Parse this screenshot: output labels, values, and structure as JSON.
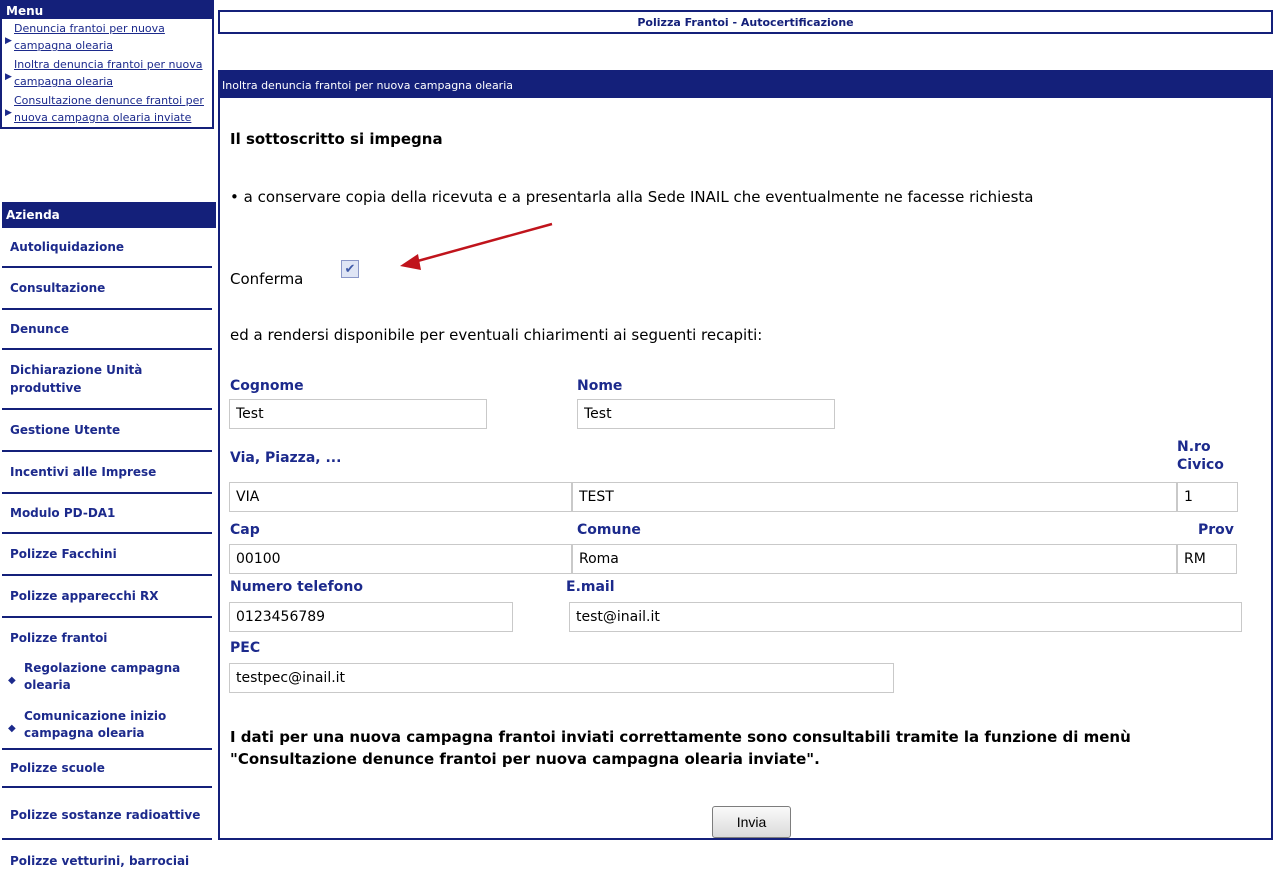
{
  "sidebar": {
    "menu_title": "Menu",
    "menu_links": [
      {
        "label": "Denuncia frantoi per nuova campagna olearia"
      },
      {
        "label": "Inoltra denuncia frantoi per nuova campagna olearia"
      },
      {
        "label": "Consultazione denunce frantoi per nuova campagna olearia inviate"
      }
    ],
    "azienda_title": "Azienda",
    "azienda_items": [
      "Autoliquidazione",
      "Consultazione",
      "Denunce",
      "Dichiarazione Unità produttive",
      "Gestione Utente",
      "Incentivi alle Imprese",
      "Modulo PD-DA1",
      "Polizze Facchini",
      "Polizze apparecchi RX",
      "Polizze frantoi",
      "Polizze scuole",
      "Polizze sostanze radioattive",
      "Polizze vetturini, barrociai"
    ],
    "frantoi_subitems": [
      "Regolazione campagna olearia",
      "Comunicazione inizio campagna olearia"
    ]
  },
  "main": {
    "title": "Polizza Frantoi - Autocertificazione",
    "panel_header": "Inoltra denuncia frantoi per nuova campagna olearia",
    "heading": "Il sottoscritto si impegna",
    "bullet_text": "• a conservare copia della ricevuta e a presentarla alla Sede INAIL che eventualmente ne facesse richiesta",
    "confirm_label": "Conferma",
    "confirm_checked": true,
    "contacts_intro": "ed a rendersi disponibile per eventuali chiarimenti ai seguenti recapiti:",
    "form": {
      "cognome_label": "Cognome",
      "cognome_value": "Test",
      "nome_label": "Nome",
      "nome_value": "Test",
      "via_label": "Via, Piazza, ...",
      "via_type_value": "VIA",
      "via_name_value": "TEST",
      "civico_label": "N.ro Civico",
      "civico_value": "1",
      "cap_label": "Cap",
      "cap_value": "00100",
      "comune_label": "Comune",
      "comune_value": "Roma",
      "prov_label": "Prov",
      "prov_value": "RM",
      "telefono_label": "Numero telefono",
      "telefono_value": "0123456789",
      "email_label": "E.mail",
      "email_value": "test@inail.it",
      "pec_label": "PEC",
      "pec_value": "testpec@inail.it"
    },
    "note": "I dati per una nuova campagna frantoi inviati correttamente sono consultabili tramite la funzione di menù \"Consultazione denunce frantoi per nuova campagna olearia inviate\".",
    "submit_label": "Invia"
  },
  "colors": {
    "navy": "#14207a",
    "link": "#1c2a8c",
    "arrow": "#c0141c"
  }
}
